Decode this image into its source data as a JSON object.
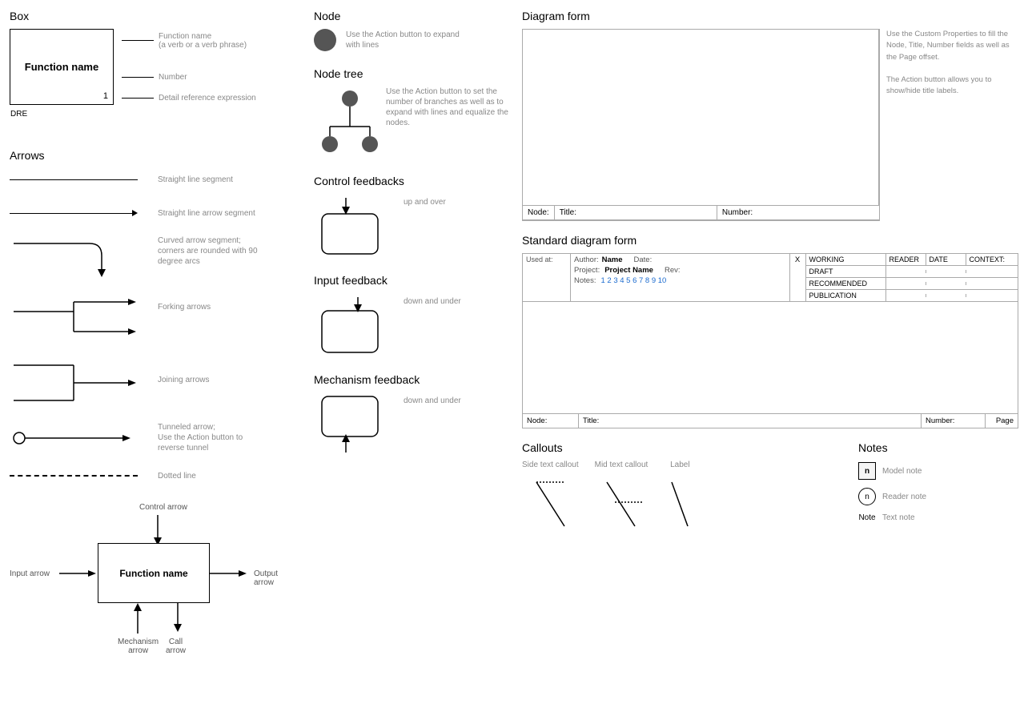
{
  "box": {
    "title": "Box",
    "function_name": "Function name",
    "number": "1",
    "dre": "DRE",
    "label_function": "Function name",
    "label_function_sub": "(a verb or a verb phrase)",
    "label_number": "Number",
    "label_dre": "Detail reference expression"
  },
  "node": {
    "title": "Node",
    "desc": "Use the Action button to expand with lines"
  },
  "node_tree": {
    "title": "Node tree",
    "desc": "Use the Action button to set the number of branches as well as to expand with lines and equalize the nodes."
  },
  "arrows": {
    "title": "Arrows",
    "items": [
      {
        "label": "Straight line segment"
      },
      {
        "label": "Straight line arrow segment"
      },
      {
        "label": "Curved arrow segment; corners are rounded with 90 degree arcs"
      },
      {
        "label": "Forking arrows"
      },
      {
        "label": "Joining arrows"
      },
      {
        "label": "Tunneled arrow; Use the Action button to reverse tunnel"
      },
      {
        "label": "Dotted line"
      }
    ]
  },
  "control_feedbacks": {
    "title": "Control feedbacks",
    "label": "up and over"
  },
  "input_feedback": {
    "title": "Input feedback",
    "label": "down and under"
  },
  "mechanism_feedback": {
    "title": "Mechanism feedback",
    "label": "down and under"
  },
  "function_diagram": {
    "control_arrow": "Control arrow",
    "input_arrow": "Input arrow",
    "output_arrow": "Output arrow",
    "function_name": "Function name",
    "mechanism_arrow": "Mechanism arrow",
    "call_arrow": "Call arrow"
  },
  "diagram_form": {
    "title": "Diagram form",
    "notes": "Use the Custom Properties to fill the Node, Title, Number fields as well as the Page offset.\n\nThe Action button allows you to show/hide title labels.",
    "node_label": "Node:",
    "title_label": "Title:",
    "number_label": "Number:"
  },
  "std_form": {
    "title": "Standard diagram form",
    "used_at": "Used at:",
    "author_label": "Author:",
    "project_label": "Project:",
    "notes_label": "Notes:",
    "name_value": "Name",
    "project_name": "Project Name",
    "date_label": "Date:",
    "rev_label": "Rev:",
    "x_label": "X",
    "working": "WORKING",
    "draft": "DRAFT",
    "recommended": "RECOMMENDED",
    "publication": "PUBLICATION",
    "reader_label": "READER",
    "date_col": "DATE",
    "context_label": "CONTEXT:",
    "notes_numbers": "1 2 3 4 5 6 7 8 9 10",
    "node_label": "Node:",
    "title_label": "Title:",
    "number_label": "Number:",
    "page_label": "Page"
  },
  "callouts": {
    "title": "Callouts",
    "side_text": "Side text callout",
    "mid_text": "Mid text callout",
    "label_text": "Label"
  },
  "notes": {
    "title": "Notes",
    "model_note_char": "n",
    "model_note_label": "Model note",
    "reader_note_char": "n",
    "reader_note_label": "Reader note",
    "text_note_word": "Note",
    "text_note_label": "Text note"
  }
}
